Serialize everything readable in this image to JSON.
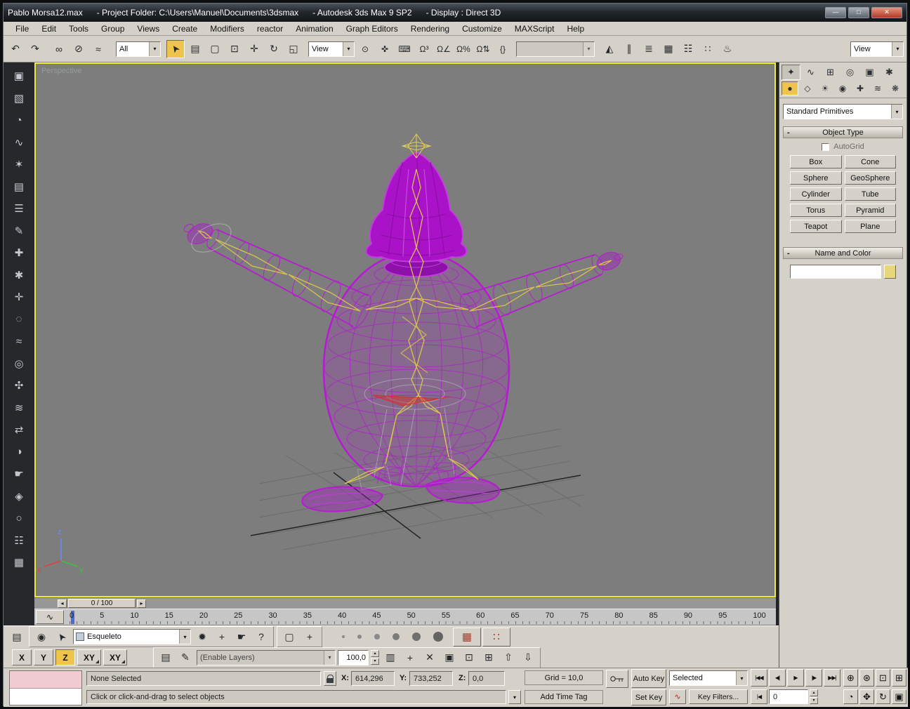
{
  "colors": {
    "active_viewport_border": "#f0e83a",
    "selection_highlight": "#efc44c",
    "wireframe_magenta": "#b719d4",
    "bone_yellow": "#dcc84e",
    "selected_bone_red": "#d83028",
    "name_color_swatch": "#e7d77c",
    "viewport_background": "#7d7d7d"
  },
  "window": {
    "title": "Pablo Morsa12.max      - Project Folder: C:\\Users\\Manuel\\Documents\\3dsmax      - Autodesk 3ds Max 9 SP2      - Display : Direct 3D",
    "buttons": {
      "minimize": "—",
      "maximize": "□",
      "close": "✕"
    }
  },
  "menu": {
    "items": [
      "File",
      "Edit",
      "Tools",
      "Group",
      "Views",
      "Create",
      "Modifiers",
      "reactor",
      "Animation",
      "Graph Editors",
      "Rendering",
      "Customize",
      "MAXScript",
      "Help"
    ]
  },
  "toolbar": {
    "selection_filter_value": "All",
    "ref_coord_value": "View",
    "render_type_value": "View",
    "named_selection_value": "",
    "select_arrow_glyph": "➤",
    "icons_history": [
      {
        "name": "undo-icon",
        "glyph": "↶"
      },
      {
        "name": "redo-icon",
        "glyph": "↷"
      }
    ],
    "icons_link": [
      {
        "name": "select-and-link-icon",
        "glyph": "∞"
      },
      {
        "name": "unlink-selection-icon",
        "glyph": "⊘"
      },
      {
        "name": "bind-to-space-warp-icon",
        "glyph": "≈"
      }
    ],
    "icons_select": [
      {
        "name": "select-by-name-icon",
        "glyph": "▤"
      },
      {
        "name": "rectangular-selection-region-icon",
        "glyph": "▢"
      },
      {
        "name": "window-crossing-icon",
        "glyph": "⊡"
      },
      {
        "name": "select-and-move-icon",
        "glyph": "✛"
      },
      {
        "name": "select-and-rotate-icon",
        "glyph": "↻"
      },
      {
        "name": "select-and-scale-icon",
        "glyph": "◱"
      }
    ],
    "icons_snap": [
      {
        "name": "use-pivot-point-center-icon",
        "glyph": "⊙"
      },
      {
        "name": "select-and-manipulate-icon",
        "glyph": "✜"
      },
      {
        "name": "keyboard-override-icon",
        "glyph": "⌨"
      },
      {
        "name": "snaps-toggle-3d-icon",
        "glyph": "Ω³"
      },
      {
        "name": "angle-snap-icon",
        "glyph": "Ω∠"
      },
      {
        "name": "percent-snap-icon",
        "glyph": "Ω%"
      },
      {
        "name": "spinner-snap-icon",
        "glyph": "Ω⇅"
      },
      {
        "name": "edit-named-selection-sets-icon",
        "glyph": "{}"
      }
    ],
    "icons_right": [
      {
        "name": "mirror-icon",
        "glyph": "◭"
      },
      {
        "name": "align-icon",
        "glyph": "∥"
      },
      {
        "name": "layer-manager-icon",
        "glyph": "≣"
      },
      {
        "name": "curve-editor-icon",
        "glyph": "▦"
      },
      {
        "name": "schematic-view-icon",
        "glyph": "☷"
      },
      {
        "name": "material-editor-icon",
        "glyph": "∷"
      },
      {
        "name": "render-scene-icon",
        "glyph": "♨"
      }
    ]
  },
  "left_toolbar": {
    "icons": [
      {
        "name": "rigid-body-collection-icon",
        "glyph": "▣"
      },
      {
        "name": "cloth-collection-icon",
        "glyph": "▧"
      },
      {
        "name": "soft-body-collection-icon",
        "glyph": "◔"
      },
      {
        "name": "rope-collection-icon",
        "glyph": "∿"
      },
      {
        "name": "deforming-mesh-icon",
        "glyph": "✶"
      },
      {
        "name": "plane-icon",
        "glyph": "▤"
      },
      {
        "name": "spring-icon",
        "glyph": "☰"
      },
      {
        "name": "dashpot-icon",
        "glyph": "✎"
      },
      {
        "name": "hinge-icon",
        "glyph": "✚"
      },
      {
        "name": "point-point-constraint-icon",
        "glyph": "✱"
      },
      {
        "name": "prismatic-constraint-icon",
        "glyph": "✛"
      },
      {
        "name": "car-wheel-constraint-icon",
        "glyph": "◌"
      },
      {
        "name": "wind-icon",
        "glyph": "≈"
      },
      {
        "name": "motor-icon",
        "glyph": "◎"
      },
      {
        "name": "fracture-icon",
        "glyph": "✣"
      },
      {
        "name": "water-icon",
        "glyph": "≋"
      },
      {
        "name": "toy-car-icon",
        "glyph": "⇄"
      },
      {
        "name": "preview-animation-icon",
        "glyph": "◑"
      },
      {
        "name": "create-animation-icon",
        "glyph": "☛"
      },
      {
        "name": "analyze-world-icon",
        "glyph": "◈"
      },
      {
        "name": "solver-icon",
        "glyph": "○"
      },
      {
        "name": "properties-icon",
        "glyph": "☷"
      },
      {
        "name": "utilities-open-icon",
        "glyph": "▦"
      }
    ]
  },
  "viewport": {
    "label": "Perspective",
    "axis_x": "x",
    "axis_y": "y",
    "axis_z": "z"
  },
  "command_panel": {
    "tabs": [
      {
        "name": "tab-create-icon",
        "glyph": "✦"
      },
      {
        "name": "tab-modify-icon",
        "glyph": "∿"
      },
      {
        "name": "tab-hierarchy-icon",
        "glyph": "⊞"
      },
      {
        "name": "tab-motion-icon",
        "glyph": "◎"
      },
      {
        "name": "tab-display-icon",
        "glyph": "▣"
      },
      {
        "name": "tab-utilities-icon",
        "glyph": "✱"
      }
    ],
    "categories": [
      {
        "name": "category-geometry-icon",
        "glyph": "●"
      },
      {
        "name": "category-shapes-icon",
        "glyph": "◇"
      },
      {
        "name": "category-lights-icon",
        "glyph": "☀"
      },
      {
        "name": "category-cameras-icon",
        "glyph": "◉"
      },
      {
        "name": "category-helpers-icon",
        "glyph": "✚"
      },
      {
        "name": "category-space-warps-icon",
        "glyph": "≋"
      },
      {
        "name": "category-systems-icon",
        "glyph": "❋"
      }
    ],
    "subcategory_value": "Standard Primitives",
    "rollout_object_type": "Object Type",
    "rollout_collapse_glyph": "-",
    "autogrid_label": "AutoGrid",
    "object_buttons": [
      "Box",
      "Cone",
      "Sphere",
      "GeoSphere",
      "Cylinder",
      "Tube",
      "Torus",
      "Pyramid",
      "Teapot",
      "Plane"
    ],
    "rollout_name_color": "Name and Color",
    "name_field_value": ""
  },
  "timeline": {
    "slider_label": "0 / 100",
    "mini_curve_glyph": "∿",
    "ticks": [
      "0",
      "5",
      "10",
      "15",
      "20",
      "25",
      "30",
      "35",
      "40",
      "45",
      "50",
      "55",
      "60",
      "65",
      "70",
      "75",
      "80",
      "85",
      "90",
      "95",
      "100"
    ]
  },
  "trackbar_row": {
    "dock_icon": {
      "name": "track-view-dock-icon",
      "glyph": "▤"
    },
    "eye_glyph": "◉",
    "cursor_glyph": "➤",
    "layer_name": "Esqueleto",
    "icons_a": [
      {
        "name": "light-toggle-icon",
        "glyph": "✹"
      },
      {
        "name": "add-icon",
        "glyph": "+"
      },
      {
        "name": "pick-cursor-icon",
        "glyph": "☛"
      },
      {
        "name": "help-pick-icon",
        "glyph": "?"
      }
    ],
    "icons_b": [
      {
        "name": "marquee-select-icon",
        "glyph": "▢"
      },
      {
        "name": "add-key-icon",
        "glyph": "+"
      }
    ],
    "buttons": [
      {
        "name": "key-table-icon",
        "glyph": "▦"
      },
      {
        "name": "dot-matrix-icon",
        "glyph": "∷"
      }
    ]
  },
  "axis_constraints": {
    "x": "X",
    "y": "Y",
    "z": "Z",
    "xy": "XY",
    "xy2": "XY"
  },
  "layers_row": {
    "pre_icons": [
      {
        "name": "layer-list-icon",
        "glyph": "▤"
      },
      {
        "name": "edit-current-layer-icon",
        "glyph": "✎"
      }
    ],
    "enable_layers_value": "(Enable Layers)",
    "weight_value": "100,0",
    "icons": [
      {
        "name": "new-layer-icon",
        "glyph": "▥"
      },
      {
        "name": "add-to-layer-icon",
        "glyph": "+"
      },
      {
        "name": "delete-layer-icon",
        "glyph": "✕"
      },
      {
        "name": "copy-layer-icon",
        "glyph": "▣"
      },
      {
        "name": "paste-layer-icon",
        "glyph": "⊡"
      },
      {
        "name": "collapse-layer-icon",
        "glyph": "⊞"
      },
      {
        "name": "layer-up-icon",
        "glyph": "⇧"
      },
      {
        "name": "layer-down-icon",
        "glyph": "⇩"
      }
    ]
  },
  "status": {
    "selection_text": "None Selected",
    "x_label": "X:",
    "x_value": "614,296",
    "y_label": "Y:",
    "y_value": "733,252",
    "z_label": "Z:",
    "z_value": "0,0",
    "grid_label": "Grid = 10,0",
    "add_time_tag_label": "Add Time Tag",
    "prompt_text": "Click or click-and-drag to select objects",
    "auto_key_label": "Auto Key",
    "set_key_label": "Set Key",
    "key_mode_value": "Selected",
    "key_filters_label": "Key Filters...",
    "time_value": "0",
    "tangent_glyph": "∿"
  },
  "playback": {
    "buttons": [
      {
        "name": "go-to-start-icon",
        "glyph": "|◀◀"
      },
      {
        "name": "previous-frame-icon",
        "glyph": "◀|"
      },
      {
        "name": "play-icon",
        "glyph": "▶"
      },
      {
        "name": "next-frame-icon",
        "glyph": "|▶"
      },
      {
        "name": "go-to-end-icon",
        "glyph": "▶▶|"
      }
    ],
    "key_step_glyph": "|◀"
  },
  "nav": {
    "row1": [
      {
        "name": "zoom-icon",
        "glyph": "⊕"
      },
      {
        "name": "zoom-all-icon",
        "glyph": "⊛"
      },
      {
        "name": "zoom-extents-icon",
        "glyph": "⊡"
      },
      {
        "name": "zoom-extents-all-icon",
        "glyph": "⊞"
      }
    ],
    "row2": [
      {
        "name": "field-of-view-icon",
        "glyph": "◔"
      },
      {
        "name": "pan-icon",
        "glyph": "✥"
      },
      {
        "name": "arc-rotate-icon",
        "glyph": "↻"
      },
      {
        "name": "min-max-toggle-icon",
        "glyph": "▣"
      }
    ]
  },
  "glyphs": {
    "chevron_down": "▾",
    "spinner_up": "▴",
    "spinner_down": "▾",
    "slider_left": "◂",
    "slider_right": "▸"
  }
}
